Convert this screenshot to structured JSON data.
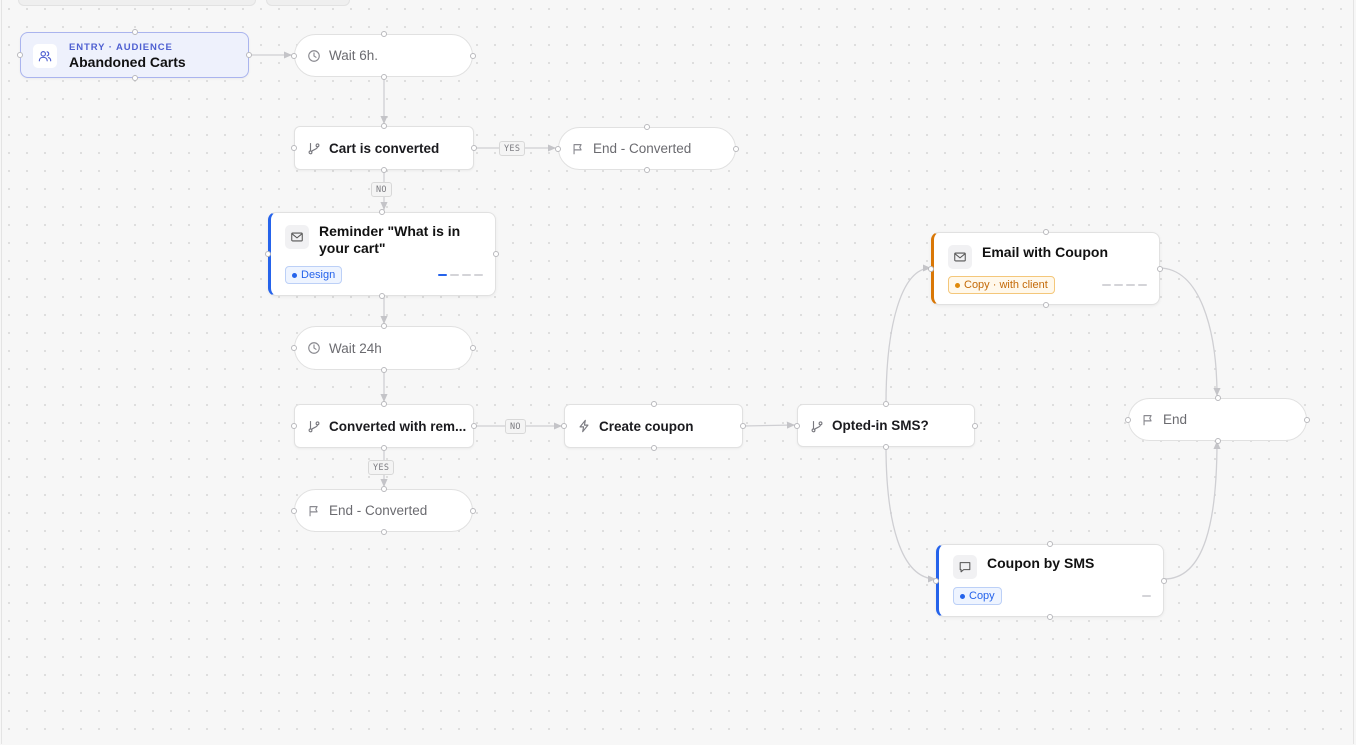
{
  "entry": {
    "kicker": "ENTRY · AUDIENCE",
    "title": "Abandoned Carts"
  },
  "nodes": {
    "wait1": "Wait 6h.",
    "cart_converted": "Cart is converted",
    "end_converted_1": "End - Converted",
    "reminder": {
      "title": "Reminder \"What is in your cart\"",
      "badge": "Design",
      "progress": {
        "done": 1,
        "total": 4
      }
    },
    "wait2": "Wait 24h",
    "converted_reminder": "Converted with rem...",
    "create_coupon": "Create coupon",
    "opted_sms": "Opted-in SMS?",
    "end_converted_2": "End - Converted",
    "email_coupon": {
      "title": "Email with Coupon",
      "badge": "Copy · with client",
      "progress": {
        "done": 0,
        "total": 4
      }
    },
    "end": "End",
    "sms_coupon": {
      "title": "Coupon by SMS",
      "badge": "Copy",
      "progress": {
        "done": 0,
        "total": 1
      }
    }
  },
  "edge_labels": {
    "yes": "YES",
    "no": "NO"
  },
  "icons": [
    "users-icon",
    "clock-icon",
    "branch-icon",
    "flag-icon",
    "mail-icon",
    "bolt-icon",
    "message-icon"
  ],
  "colors": {
    "entry_accent": "#4e5fd1",
    "design_accent": "#2563eb",
    "copy_client_accent": "#d97706"
  }
}
